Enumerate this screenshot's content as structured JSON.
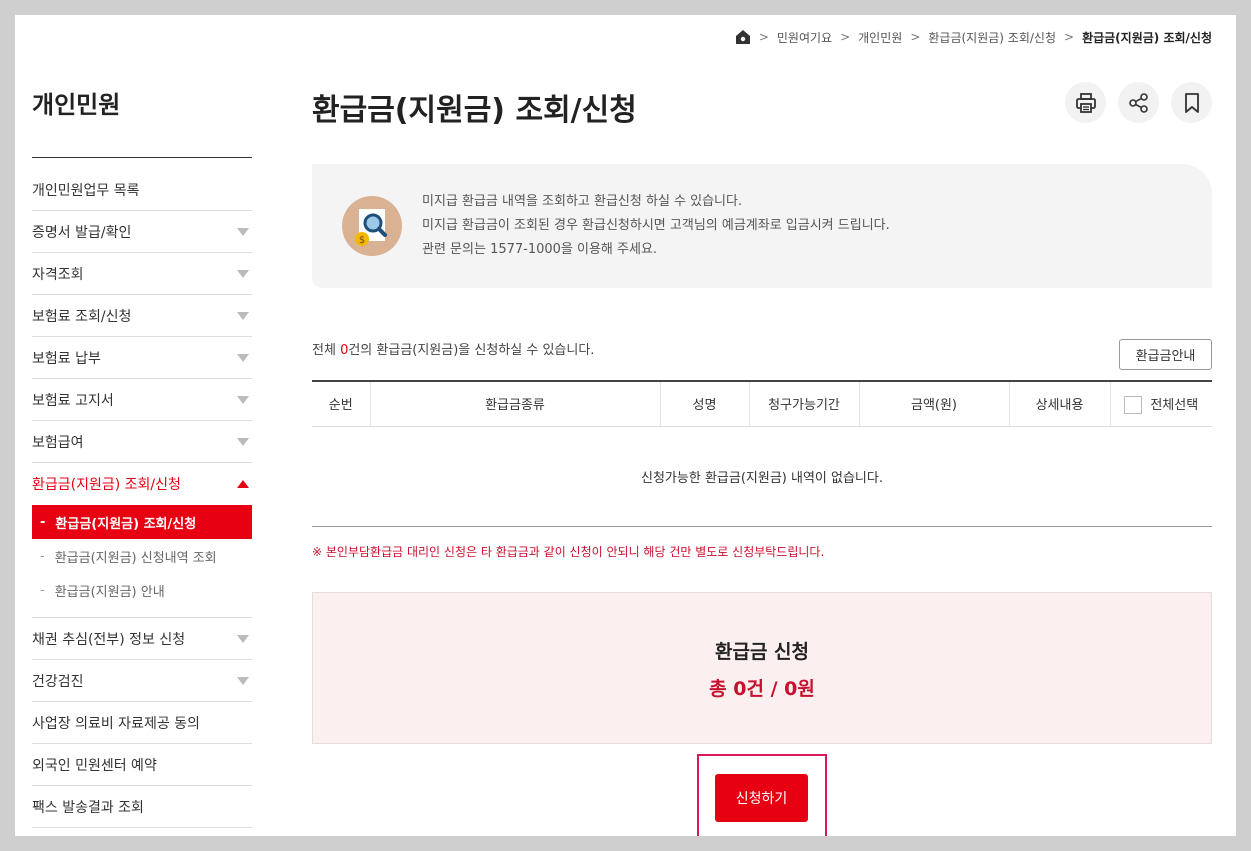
{
  "breadcrumb": {
    "items": [
      "민원여기요",
      "개인민원",
      "환급금(지원금) 조회/신청"
    ],
    "current": "환급금(지원금) 조회/신청"
  },
  "sidebar": {
    "title": "개인민원",
    "items": [
      {
        "label": "개인민원업무 목록"
      },
      {
        "label": "증명서 발급/확인"
      },
      {
        "label": "자격조회"
      },
      {
        "label": "보험료 조회/신청"
      },
      {
        "label": "보험료 납부"
      },
      {
        "label": "보험료 고지서"
      },
      {
        "label": "보험급여"
      },
      {
        "label": "환급금(지원금) 조회/신청"
      },
      {
        "label": "채권 추심(전부) 정보 신청"
      },
      {
        "label": "건강검진"
      },
      {
        "label": "사업장 의료비 자료제공 동의"
      },
      {
        "label": "외국인 민원센터 예약"
      },
      {
        "label": "팩스 발송결과 조회"
      }
    ],
    "submenu": [
      {
        "label": "환급금(지원금) 조회/신청"
      },
      {
        "label": "환급금(지원금) 신청내역 조회"
      },
      {
        "label": "환급금(지원금) 안내"
      }
    ],
    "dash": "-"
  },
  "main": {
    "title": "환급금(지원금) 조회/신청",
    "info_lines": [
      "미지급 환급금 내역을 조회하고 환급신청 하실 수 있습니다.",
      "미지급 환급금이 조회된 경우 환급신청하시면 고객님의 예금계좌로 입금시켜 드립니다.",
      "관련 문의는 1577-1000을 이용해 주세요."
    ],
    "count_prefix": "전체 ",
    "count_num": "0",
    "count_suffix": "건의 환급금(지원금)을 신청하실 수 있습니다.",
    "guide_button": "환급금안내",
    "table_headers": [
      "순번",
      "환급금종류",
      "성명",
      "청구가능기간",
      "금액(원)",
      "상세내용",
      "전체선택"
    ],
    "empty_message": "신청가능한 환급금(지원금) 내역이 없습니다.",
    "notice": "※ 본인부담환급금 대리인 신청은 타 환급금과 같이 신청이 안되니 해당 건만 별도로 신청부탁드립니다.",
    "summary_title": "환급금 신청",
    "summary_total": "총 0건 / 0원",
    "apply_button": "신청하기"
  },
  "colors": {
    "accent": "#e60012",
    "notice": "#c8102e"
  }
}
